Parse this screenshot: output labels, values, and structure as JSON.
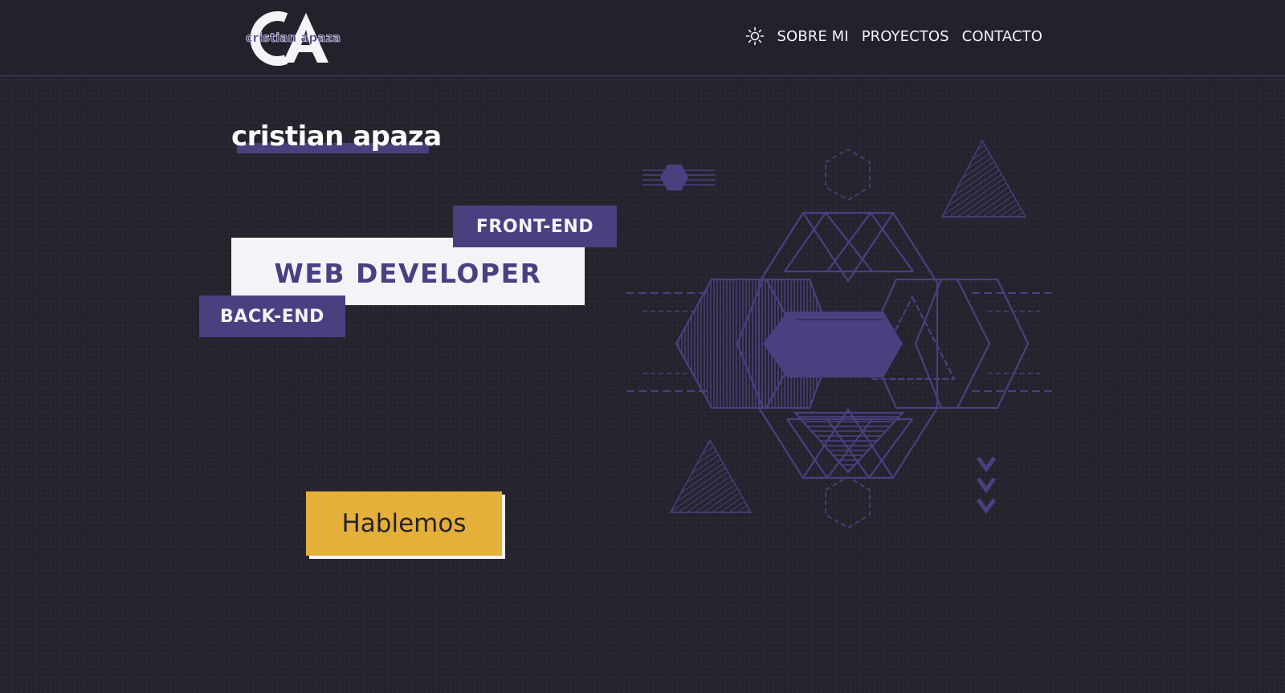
{
  "header": {
    "logo_text": "cristian apaza",
    "logo_initials": "CA",
    "nav": {
      "about": "SOBRE MI",
      "projects": "PROYECTOS",
      "contact": "CONTACTO"
    },
    "theme_icon": "sun-icon"
  },
  "hero": {
    "name": "cristian apaza",
    "title": "WEB DEVELOPER",
    "tag_front": "FRONT-END",
    "tag_back": "BACK-END",
    "cta": "Hablemos",
    "scroll_icon": "chevrons-down-icon"
  },
  "colors": {
    "background": "#26232e",
    "navbar": "#23212b",
    "accent": "#4b3f80",
    "light": "#f4f3f8",
    "cta": "#e4b03a"
  }
}
